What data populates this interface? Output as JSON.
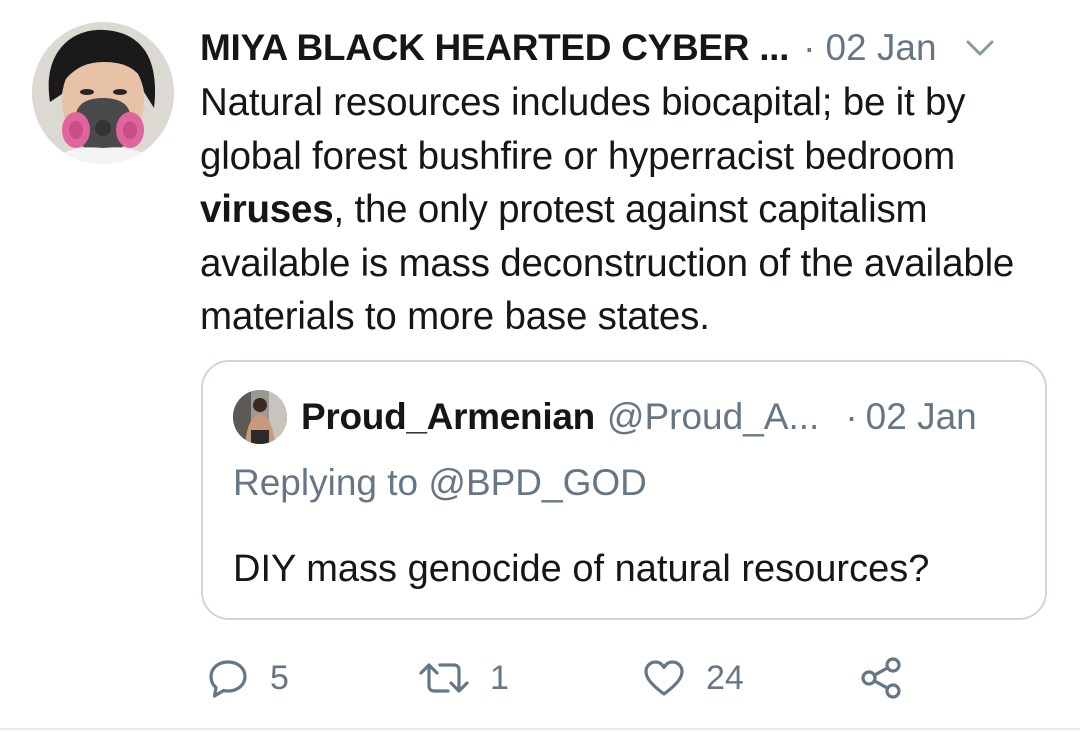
{
  "tweet": {
    "display_name": "MIYA BLACK HEARTED CYBER ...",
    "separator": "·",
    "date": "02 Jan",
    "body_before": "Natural resources includes biocapital; be it by global forest bushfire or hyperracist bedroom ",
    "body_bold": "viruses",
    "body_after": ", the only protest against capitalism available is mass deconstruction of the available materials to more base states."
  },
  "quoted_tweet": {
    "display_name": "Proud_Armenian",
    "handle": "@Proud_A...",
    "separator": "·",
    "date": "02 Jan",
    "replying_to": "Replying to @BPD_GOD",
    "text": "DIY mass genocide of natural resources?"
  },
  "actions": {
    "reply_count": "5",
    "retweet_count": "1",
    "like_count": "24"
  },
  "icons": {
    "reply": "reply-icon",
    "retweet": "retweet-icon",
    "like": "heart-icon",
    "share": "share-icon",
    "menu": "chevron-down-icon"
  },
  "colors": {
    "text_primary": "#14171a",
    "text_secondary": "#657786",
    "border": "#ccd6dd",
    "mask_filter_pink": "#e0649e"
  }
}
